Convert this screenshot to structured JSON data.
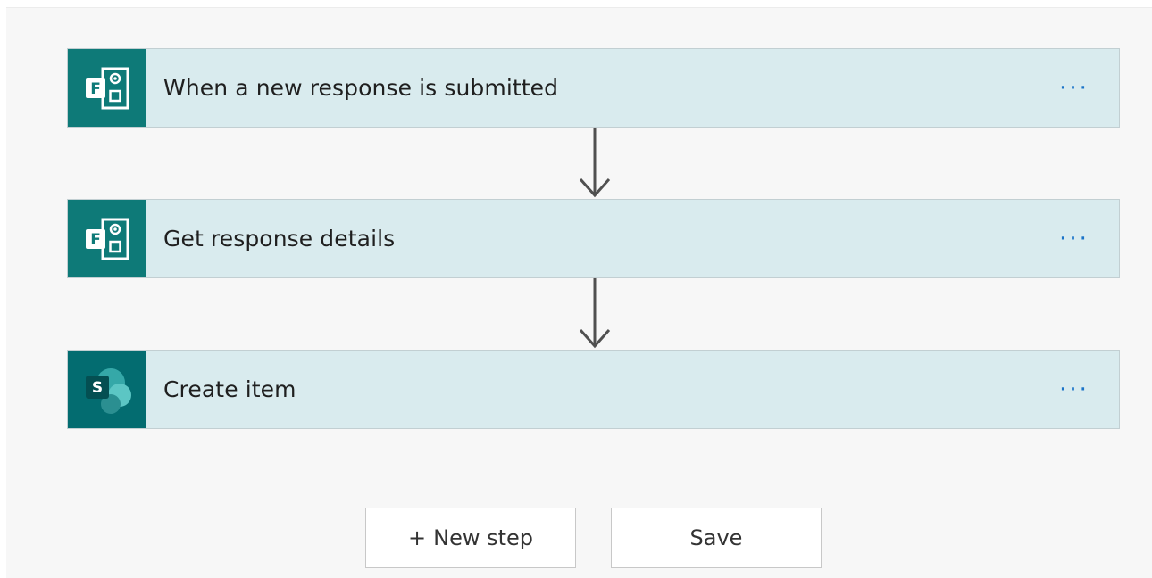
{
  "flow": {
    "steps": [
      {
        "title": "When a new response is submitted",
        "icon": "microsoft-forms-icon",
        "more": "···"
      },
      {
        "title": "Get response details",
        "icon": "microsoft-forms-icon",
        "more": "···"
      },
      {
        "title": "Create item",
        "icon": "sharepoint-icon",
        "more": "···"
      }
    ]
  },
  "actions": {
    "new_step_plus": "+",
    "new_step_label": "New step",
    "save_label": "Save"
  },
  "colors": {
    "forms_brand": "#0e7a78",
    "sharepoint_brand": "#036c70",
    "card_background": "#d9ebee",
    "more_dots": "#1a73c8",
    "canvas": "#f7f7f7"
  }
}
